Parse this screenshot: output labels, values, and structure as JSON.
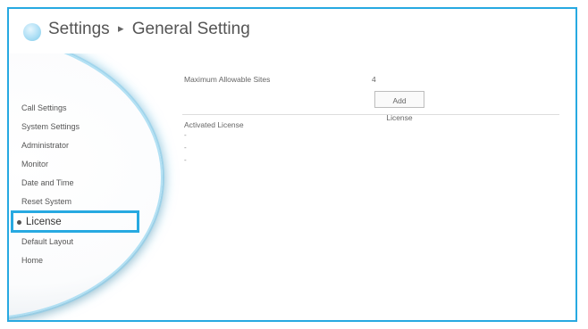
{
  "header": {
    "crumb_root": "Settings",
    "crumb_separator": "▸",
    "crumb_current": "General Setting",
    "logo_icon": "globe-logo-icon"
  },
  "sidebar": {
    "items": [
      {
        "label": "Call Settings"
      },
      {
        "label": "System Settings"
      },
      {
        "label": "Administrator"
      },
      {
        "label": "Monitor"
      },
      {
        "label": "Date and Time"
      },
      {
        "label": "Reset System"
      },
      {
        "label": "License",
        "active": true
      },
      {
        "label": "Default Layout"
      },
      {
        "label": "Home"
      }
    ]
  },
  "main": {
    "max_sites_label": "Maximum Allowable Sites",
    "max_sites_value": "4",
    "add_license_button": "Add License",
    "activated_license_label": "Activated License",
    "license_rows": [
      "-",
      "-",
      "-"
    ]
  },
  "colors": {
    "accent": "#27a9e1",
    "text": "#555555"
  }
}
